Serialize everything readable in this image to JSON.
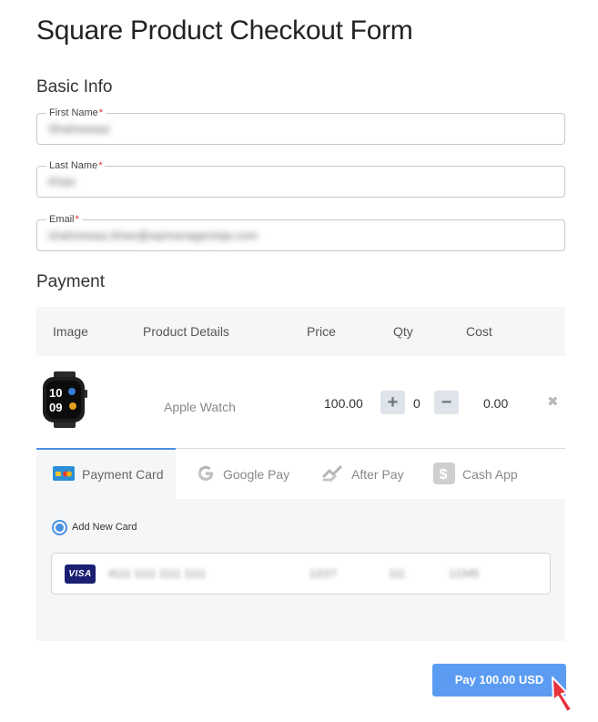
{
  "page": {
    "title": "Square Product Checkout Form"
  },
  "basic_info": {
    "heading": "Basic Info",
    "fields": [
      {
        "label": "First Name",
        "required": "*",
        "value": "Shahnewaz"
      },
      {
        "label": "Last Name",
        "required": "*",
        "value": "Khan"
      },
      {
        "label": "Email",
        "required": "*",
        "value": "shahnewaz.khan@wpmanageninja.com"
      }
    ]
  },
  "payment": {
    "heading": "Payment",
    "table_headers": [
      "Image",
      "Product Details",
      "Price",
      "Qty",
      "Cost"
    ],
    "product": {
      "name": "Apple Watch",
      "price": "100.00",
      "qty": "0",
      "cost": "0.00",
      "plus_symbol": "+",
      "minus_symbol": "−",
      "remove_symbol": "✖"
    },
    "tabs": [
      {
        "label": "Payment Card",
        "icon": "card-icon",
        "active": true
      },
      {
        "label": "Google Pay",
        "icon": "google-icon",
        "active": false
      },
      {
        "label": "After Pay",
        "icon": "afterpay-icon",
        "active": false
      },
      {
        "label": "Cash App",
        "icon": "cashapp-icon",
        "active": false
      }
    ],
    "add_new_card_label": "Add New Card",
    "card": {
      "brand": "VISA",
      "number": "4111 1111 1111 1111",
      "expiry": "12/27",
      "cvv": "111",
      "zip": "12345"
    }
  },
  "pay_button": {
    "label": "Pay 100.00 USD"
  },
  "colors": {
    "accent": "#4a90e2",
    "button": "#5b9cf2",
    "required": "#e02b2b",
    "cursor": "#e8323c"
  }
}
